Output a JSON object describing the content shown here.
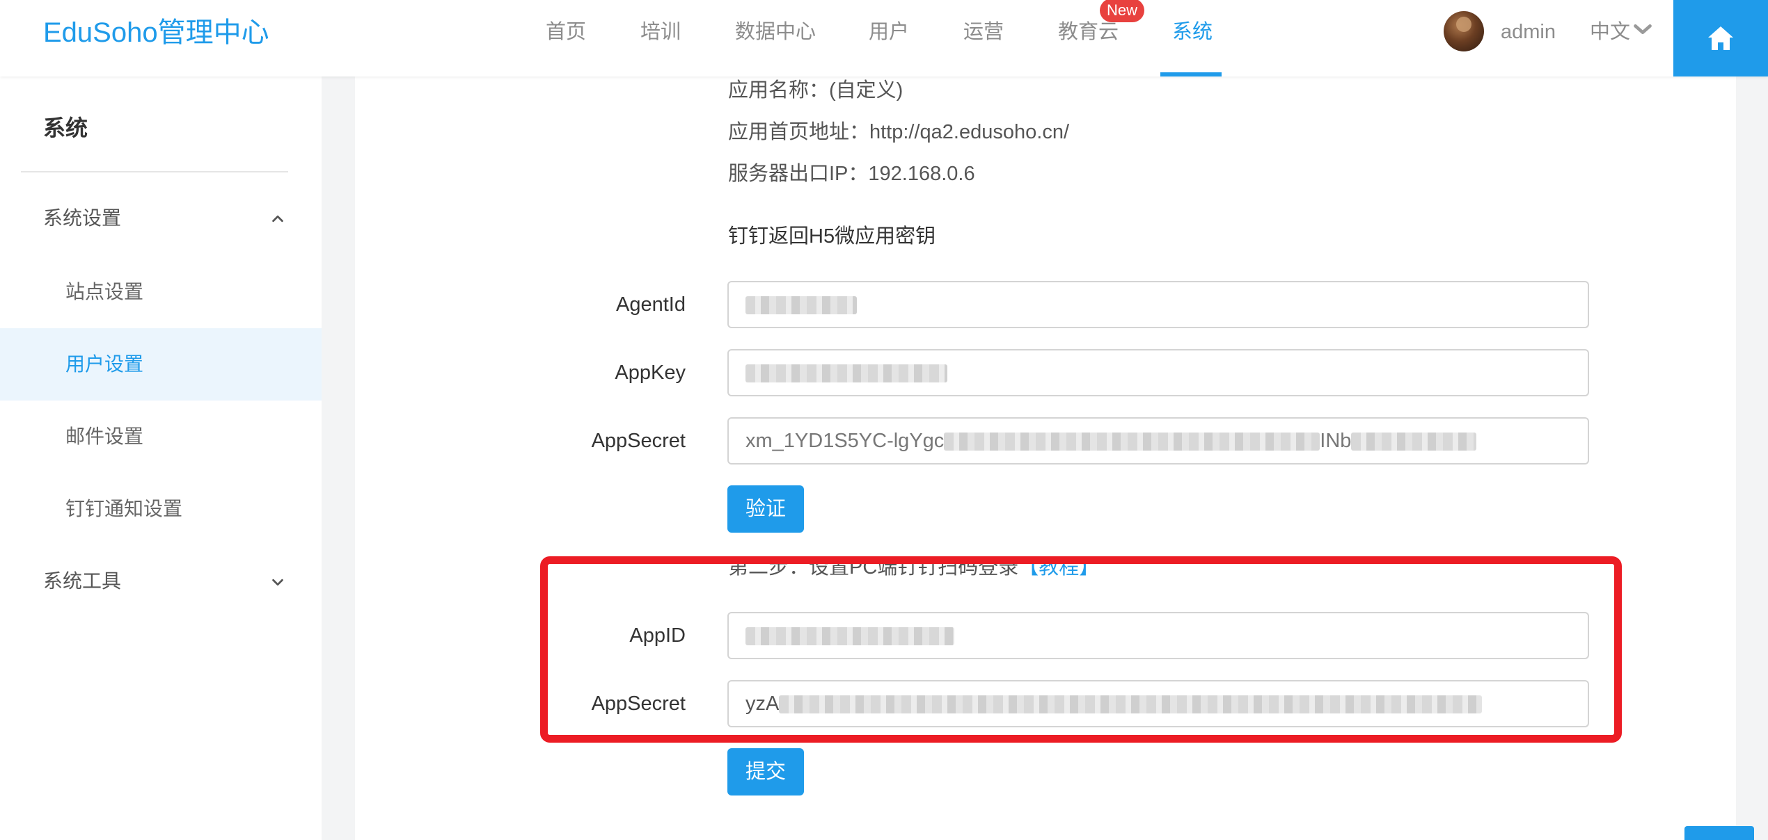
{
  "header": {
    "logo": "EduSoho管理中心",
    "nav": [
      "首页",
      "培训",
      "数据中心",
      "用户",
      "运营",
      "教育云",
      "系统"
    ],
    "active_nav": "系统",
    "new_badge": "New",
    "user": "admin",
    "language": "中文"
  },
  "sidebar": {
    "title": "系统",
    "groups": [
      {
        "label": "系统设置",
        "expanded": true
      },
      {
        "label": "系统工具",
        "expanded": false
      }
    ],
    "items": [
      "站点设置",
      "用户设置",
      "邮件设置",
      "钉钉通知设置"
    ],
    "active_item": "用户设置"
  },
  "form": {
    "app_name_line": "应用名称：(自定义)",
    "homepage_line": "应用首页地址：http://qa2.edusoho.cn/",
    "server_ip_line": "服务器出口IP：192.168.0.6",
    "h5_section": "钉钉返回H5微应用密钥",
    "agentid_label": "AgentId",
    "appkey_label": "AppKey",
    "appsecret_label": "AppSecret",
    "appsecret_value_prefix": "xm_1YD1S5YC-lgYgc",
    "appsecret_value_mid": "INb",
    "verify_button": "验证",
    "step2_text": "第二步：设置PC端钉钉扫码登录",
    "tutorial_link": "【教程】",
    "appid_label": "AppID",
    "appsecret2_label": "AppSecret",
    "appsecret2_value_prefix": "yzA",
    "submit_button": "提交"
  },
  "colors": {
    "brand": "#1f9bea",
    "highlight": "#ec1c24",
    "badge": "#e8413e"
  }
}
